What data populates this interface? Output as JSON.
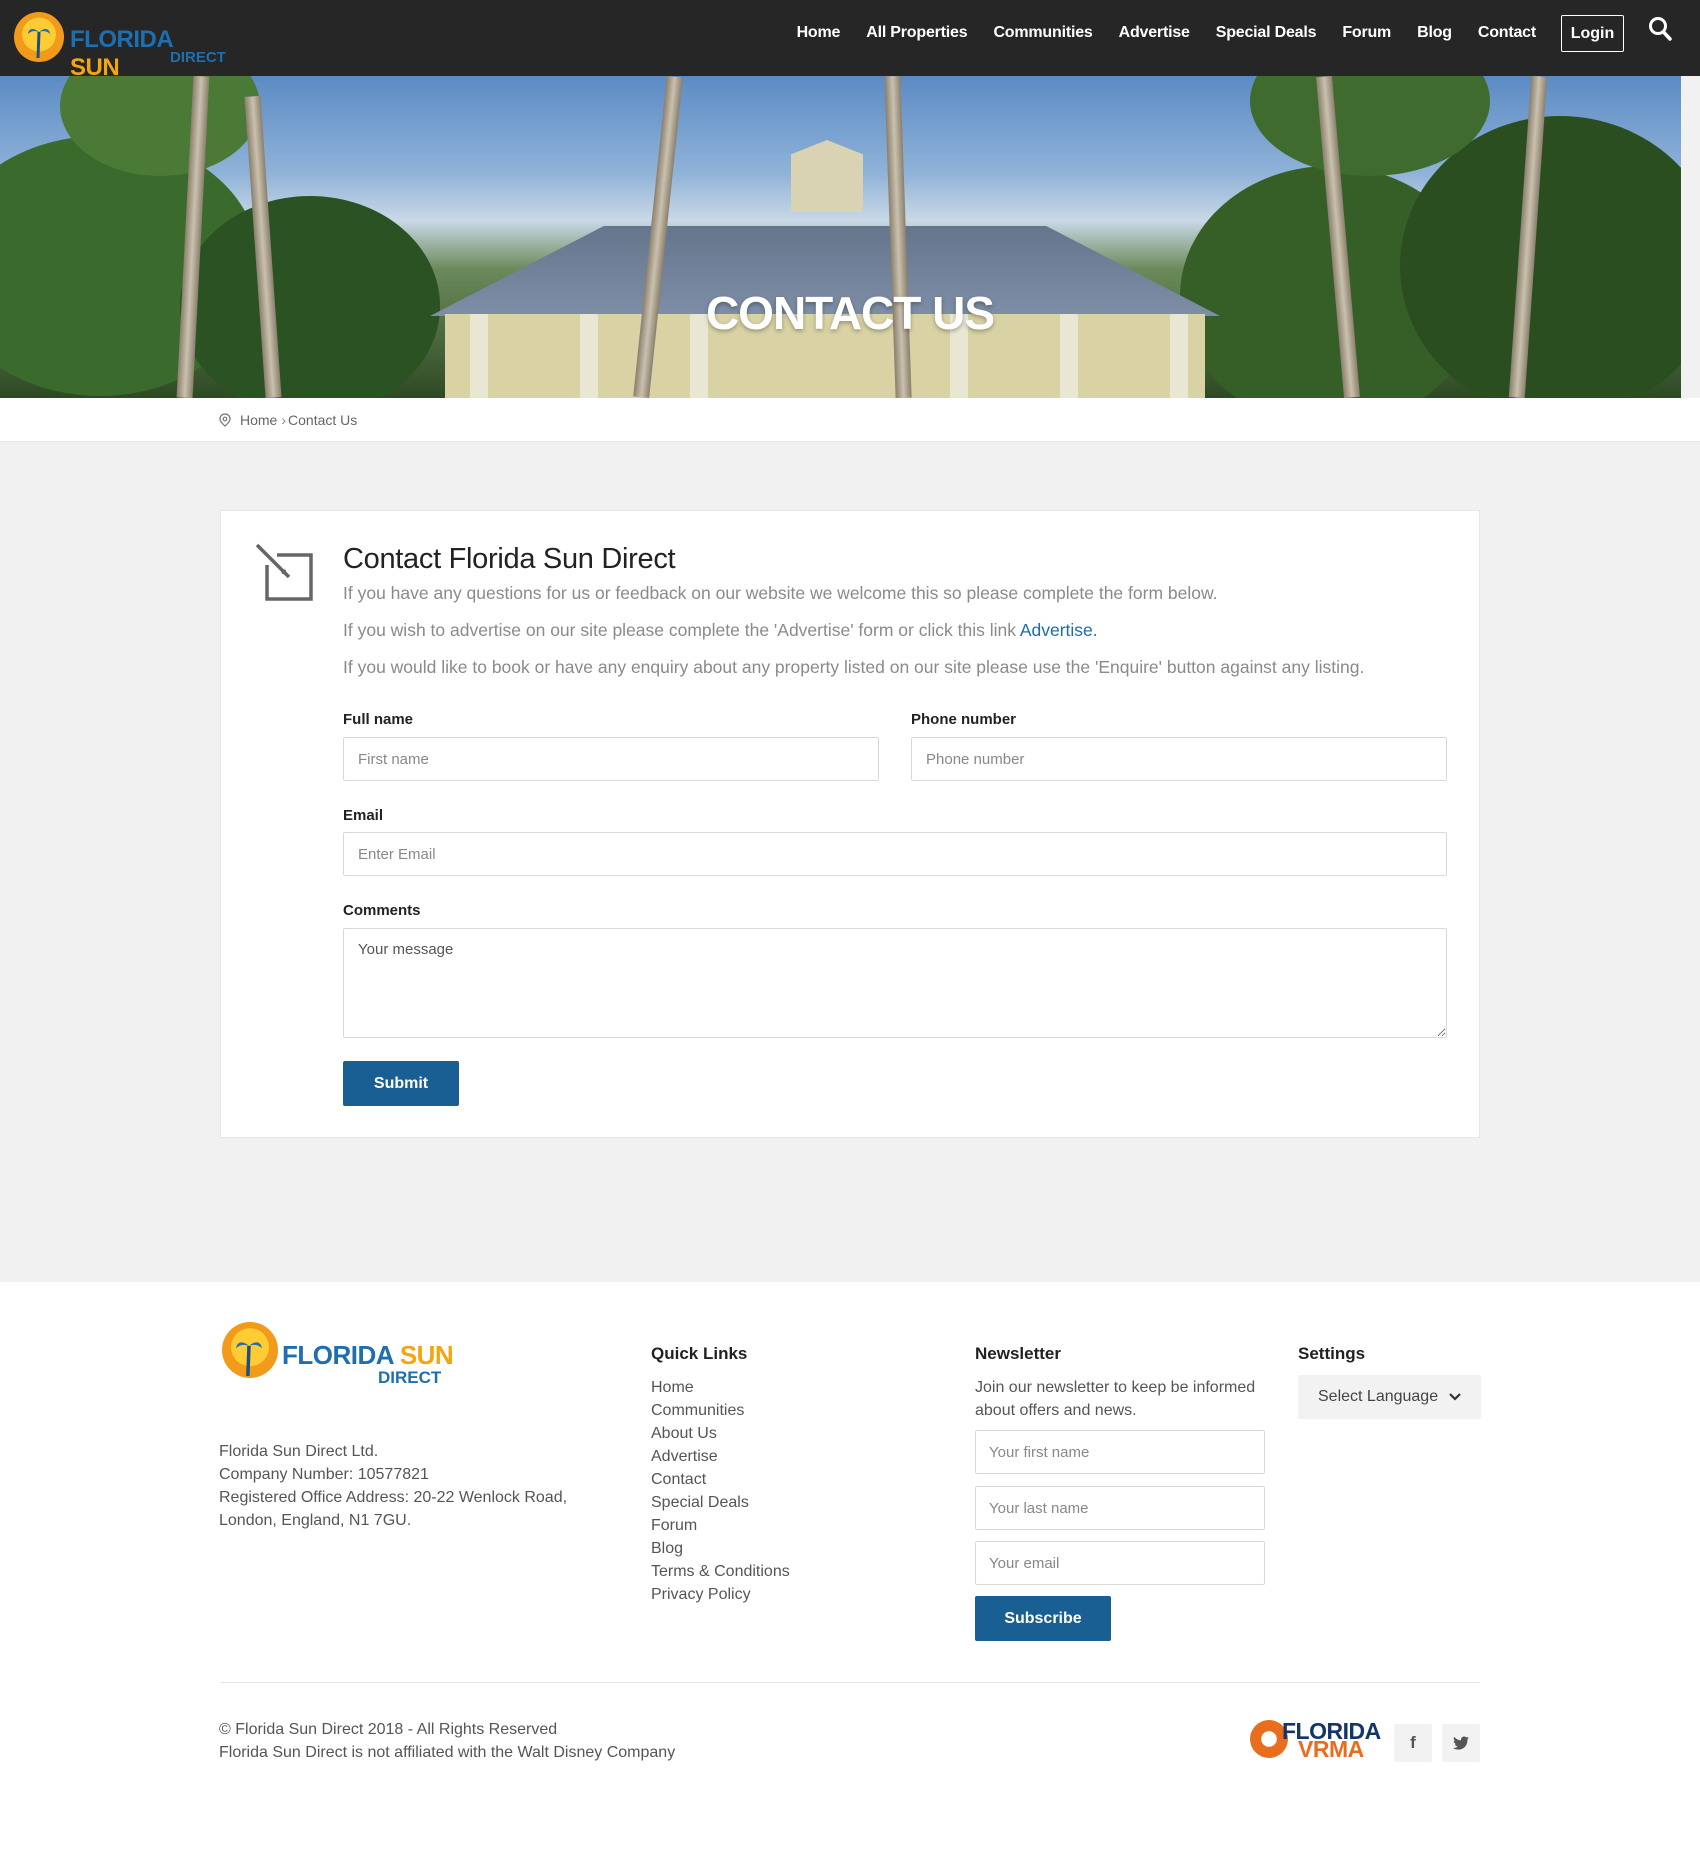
{
  "header": {
    "logo_word1": "FLORIDA",
    "logo_word2": "SUN",
    "logo_word3": "DIRECT",
    "nav": [
      "Home",
      "All Properties",
      "Communities",
      "Advertise",
      "Special Deals",
      "Forum",
      "Blog",
      "Contact"
    ],
    "login_label": "Login",
    "search_icon": "search-icon"
  },
  "hero": {
    "title": "CONTACT US"
  },
  "breadcrumb": {
    "home": "Home",
    "separator": "›",
    "current": "Contact Us",
    "icon": "location-pin-icon"
  },
  "contact": {
    "title": "Contact Florida Sun Direct",
    "para1": "If you have any questions for us or feedback on our website we welcome this so please complete the form below.",
    "para2_prefix": "If you wish to advertise on our site please complete the 'Advertise' form or click this link ",
    "para2_link": "Advertise",
    "para2_suffix": ".",
    "para3": "If you would like to book or have any enquiry about any property listed on our site please use the 'Enquire' button against any listing.",
    "fullname_label": "Full name",
    "fullname_placeholder": "First name",
    "phone_label": "Phone number",
    "phone_placeholder": "Phone number",
    "email_label": "Email",
    "email_placeholder": "Enter Email",
    "comments_label": "Comments",
    "comments_placeholder": "Your message",
    "submit_label": "Submit"
  },
  "footer": {
    "company": [
      "Florida Sun Direct Ltd.",
      "Company Number: 10577821",
      "Registered Office Address: 20-22 Wenlock Road,",
      "London, England, N1 7GU."
    ],
    "quick_links_title": "Quick Links",
    "quick_links": [
      "Home",
      "Communities",
      "About Us",
      "Advertise",
      "Contact",
      "Special Deals",
      "Forum",
      "Blog",
      "Terms & Conditions",
      "Privacy Policy"
    ],
    "newsletter_title": "Newsletter",
    "newsletter_desc": "Join our newsletter to keep be informed about offers and news.",
    "first_name_placeholder": "Your first name",
    "last_name_placeholder": "Your last name",
    "email_placeholder": "Your email",
    "subscribe_label": "Subscribe",
    "settings_title": "Settings",
    "language_label": "Select Language",
    "copyright": "© Florida Sun Direct 2018 - All Rights Reserved",
    "disclaimer": "Florida Sun Direct is not affiliated with the Walt Disney Company",
    "vrma_word1": "FLORIDA",
    "vrma_word2": "VRMA",
    "facebook_icon": "facebook-icon",
    "twitter_icon": "twitter-icon"
  },
  "colors": {
    "header_bg": "#262626",
    "accent_blue": "#1a5f93",
    "link_blue": "#1a6da9",
    "logo_orange": "#f2a614"
  }
}
